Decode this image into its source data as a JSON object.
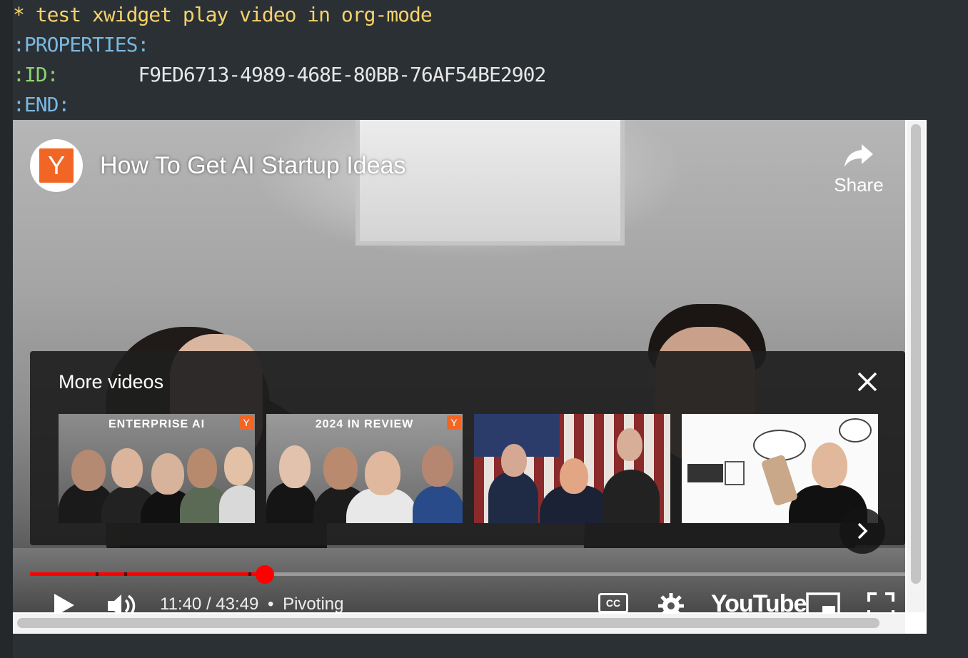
{
  "org": {
    "heading": "* test xwidget play video in org-mode",
    "properties_label": ":PROPERTIES:",
    "id_key": ":ID:",
    "id_value": "F9ED6713-4989-468E-80BB-76AF54BE2902",
    "end_label": ":END:"
  },
  "player": {
    "channel_logo_letter": "Y",
    "title": "How To Get AI Startup Ideas",
    "share_label": "Share",
    "more_videos_title": "More videos",
    "thumbnails": [
      {
        "caption": "ENTERPRISE AI",
        "badge": "Y"
      },
      {
        "caption": "2024 IN REVIEW",
        "badge": "Y"
      },
      {
        "caption": "",
        "badge": ""
      },
      {
        "caption": "",
        "badge": ""
      }
    ],
    "time": "11:40 / 43:49",
    "separator": "•",
    "chapter": "Pivoting",
    "cc_label": "CC",
    "brand_logo": "YouTube",
    "progress_fraction": 0.268,
    "colors": {
      "accent": "#ff0000",
      "channel_orange": "#f26625"
    }
  },
  "icons": [
    "share-icon",
    "close-icon",
    "chevron-right-icon",
    "play-icon",
    "volume-icon",
    "settings-icon",
    "miniplayer-icon",
    "fullscreen-icon"
  ]
}
